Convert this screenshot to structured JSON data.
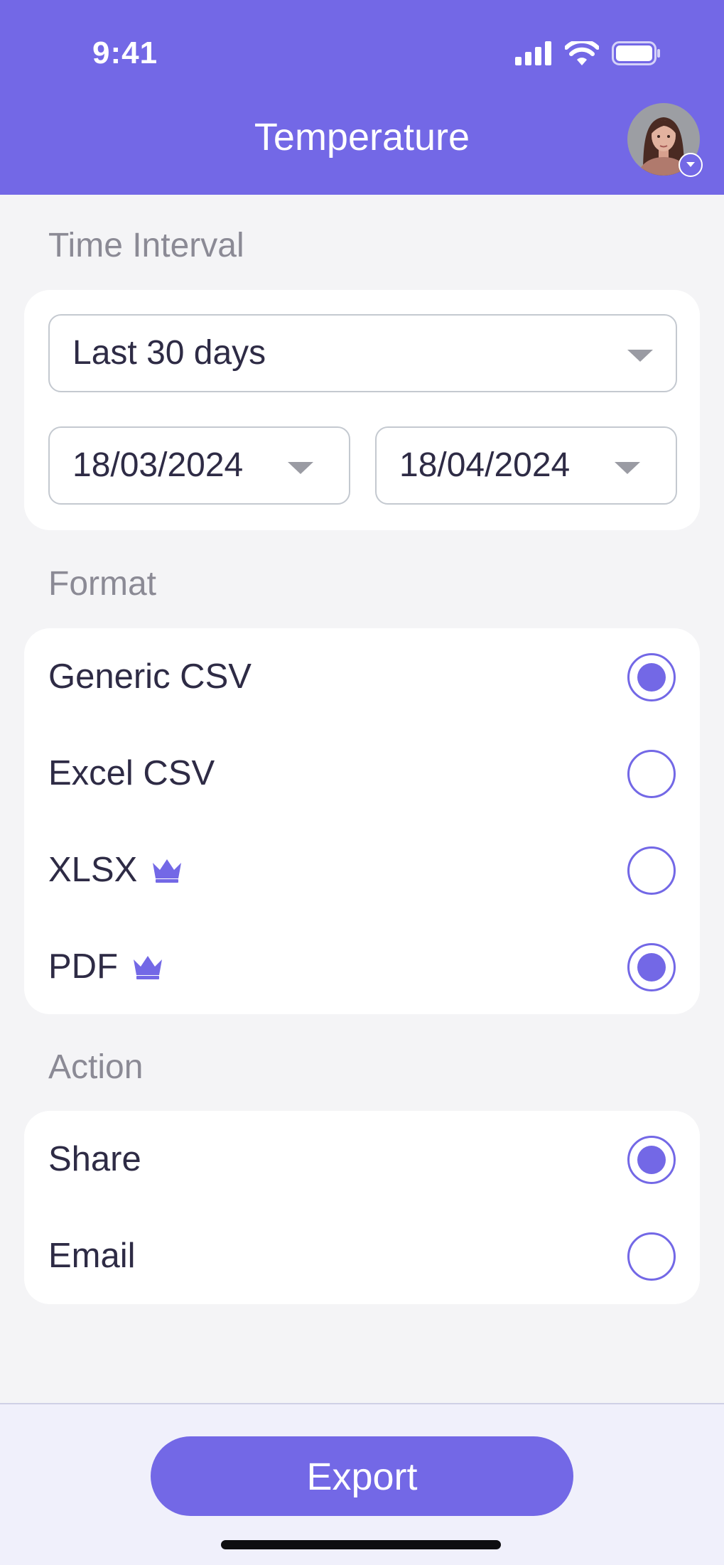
{
  "status_bar": {
    "time": "9:41"
  },
  "header": {
    "title": "Temperature"
  },
  "time_interval": {
    "label": "Time Interval",
    "range_value": "Last 30 days",
    "start_date": "18/03/2024",
    "end_date": "18/04/2024"
  },
  "format": {
    "label": "Format",
    "options": [
      {
        "label": "Generic CSV",
        "selected": true,
        "premium": false
      },
      {
        "label": "Excel CSV",
        "selected": false,
        "premium": false
      },
      {
        "label": "XLSX",
        "selected": false,
        "premium": true
      },
      {
        "label": "PDF",
        "selected": true,
        "premium": true
      }
    ]
  },
  "action": {
    "label": "Action",
    "options": [
      {
        "label": "Share",
        "selected": true
      },
      {
        "label": "Email",
        "selected": false
      }
    ]
  },
  "footer": {
    "export_label": "Export"
  },
  "colors": {
    "accent": "#7368e6",
    "background": "#f4f4f6",
    "text": "#2e2b45",
    "muted": "#8b8a95"
  },
  "icons": [
    "signal-icon",
    "wifi-icon",
    "battery-icon",
    "avatar",
    "chevron-down-icon",
    "crown-icon"
  ]
}
